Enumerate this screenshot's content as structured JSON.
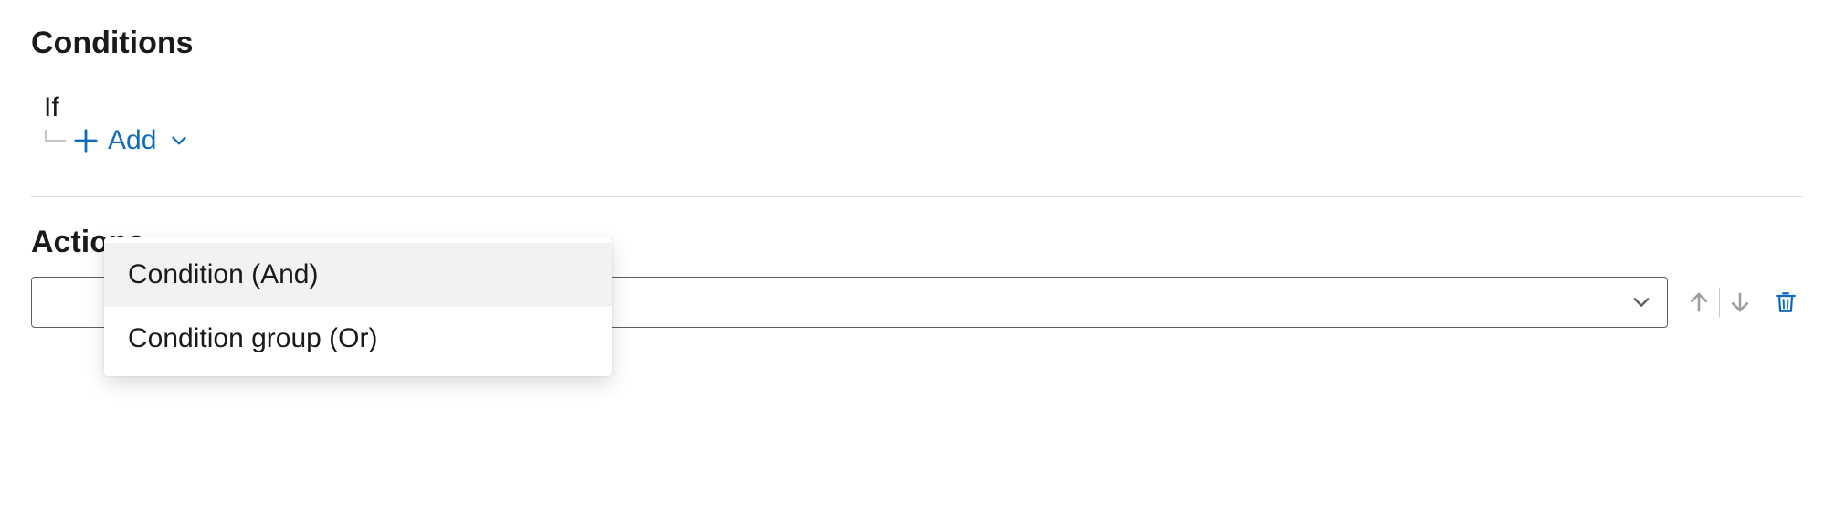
{
  "conditions": {
    "title": "Conditions",
    "if_label": "If",
    "add_label": "Add",
    "menu": {
      "option_and": "Condition (And)",
      "option_or": "Condition group (Or)"
    }
  },
  "actions": {
    "title": "Actions",
    "selected_value": ""
  },
  "colors": {
    "accent": "#0f6cbd",
    "text": "#1b1a19",
    "muted": "#a19f9d",
    "border": "#605e5c",
    "menu_hover": "#f3f2f1",
    "divider": "#e1dfdd"
  }
}
